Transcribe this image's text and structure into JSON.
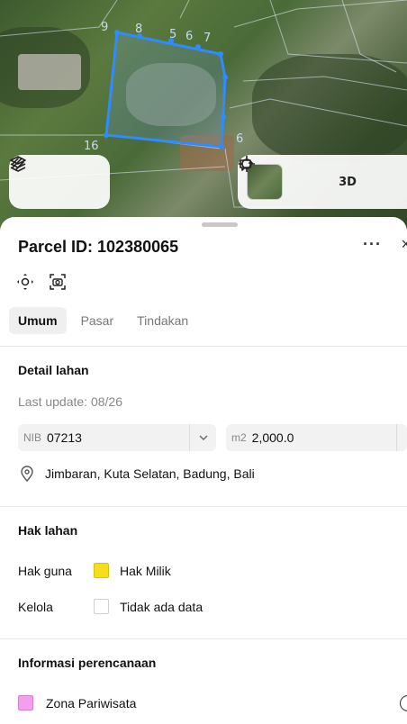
{
  "map": {
    "parcel_labels": [
      "8",
      "5",
      "6",
      "7",
      "16",
      "6",
      "9"
    ],
    "controls_left": [
      {
        "icon": "layers-icon"
      },
      {
        "icon": "draw-icon"
      }
    ],
    "controls_right": [
      {
        "icon": "satellite-thumbnail"
      },
      {
        "icon": "locate-icon"
      },
      {
        "label": "3D"
      },
      {
        "icon": "share-icon"
      }
    ]
  },
  "sheet": {
    "title": "Parcel ID: 102380065",
    "more_label": "···",
    "close_label": "×",
    "tabs": [
      {
        "label": "Umum",
        "active": true
      },
      {
        "label": "Pasar",
        "active": false
      },
      {
        "label": "Tindakan",
        "active": false
      }
    ],
    "detail": {
      "title": "Detail lahan",
      "last_update": "Last update: 08/26",
      "nib_prefix": "NIB",
      "nib_value": "07213",
      "area_prefix": "m2",
      "area_value": "2,000.0",
      "location": "Jimbaran, Kuta Selatan, Badung, Bali"
    },
    "rights": {
      "title": "Hak lahan",
      "rows": [
        {
          "key": "Hak guna",
          "value": "Hak Milik",
          "swatch": "#f5de1c"
        },
        {
          "key": "Kelola",
          "value": "Tidak ada data",
          "swatch": "#ffffff"
        }
      ]
    },
    "planning": {
      "title": "Informasi perencanaan",
      "zone": "Zona Pariwisata",
      "zone_color": "#f49ef0"
    }
  }
}
